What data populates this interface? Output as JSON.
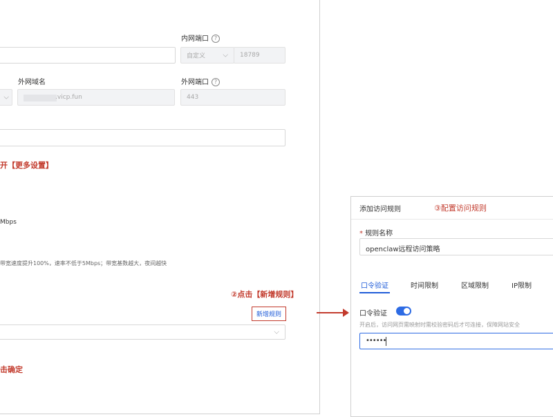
{
  "left": {
    "internal_port_label": "内网端口",
    "internal_port_mode": "自定义",
    "internal_port_value": "18789",
    "external_domain_label": "外网域名",
    "external_domain_value": ".vicp.fun",
    "external_port_label": "外网端口",
    "external_port_value": "443",
    "note_more_settings": "开【更多设置】",
    "bandwidth_unit": "Mbps",
    "bandwidth_desc": "带宽速度提升100%，速率不低于5Mbps；带宽基数越大，夜间越快",
    "note_add_rule": "②点击【新增规则】",
    "add_rule_button": "新增规则",
    "note_confirm": "击确定"
  },
  "dialog": {
    "title": "添加访问规则",
    "step_note": "③配置访问规则",
    "rule_name_label": "规则名称",
    "rule_name_required": "*",
    "rule_name_value": "openclaw远程访问策略",
    "tabs": [
      "口令验证",
      "时间限制",
      "区域限制",
      "IP限制"
    ],
    "password_verify_label": "口令验证",
    "password_verify_enabled": true,
    "password_desc": "开启后，访问网页需映射时需校验密码后才可连接，保障网站安全",
    "password_value": "••••••"
  },
  "colors": {
    "accent_blue": "#1e5bd8",
    "annotation_red": "#c23a2c"
  }
}
